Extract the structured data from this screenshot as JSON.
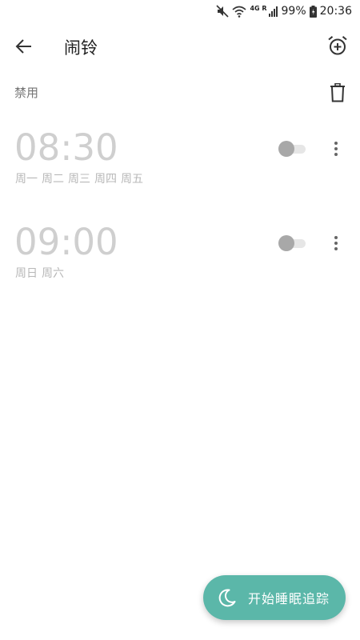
{
  "status_bar": {
    "network": "4G R",
    "battery": "99%",
    "time": "20:36",
    "icons": [
      "mute-icon",
      "wifi-icon",
      "signal-icon",
      "battery-icon"
    ]
  },
  "app_bar": {
    "title": "闹铃",
    "back_icon": "arrow-left-icon",
    "add_icon": "alarm-add-icon"
  },
  "section": {
    "label": "禁用",
    "delete_icon": "trash-icon"
  },
  "alarms": [
    {
      "time": "08:30",
      "days": [
        "周一",
        "周二",
        "周三",
        "周四",
        "周五"
      ],
      "enabled": false
    },
    {
      "time": "09:00",
      "days": [
        "周日",
        "周六"
      ],
      "enabled": false
    }
  ],
  "fab": {
    "label": "开始睡眠追踪",
    "icon": "moon-icon"
  },
  "colors": {
    "accent": "#5bb7a9",
    "time_disabled": "#cfcfcf",
    "days_disabled": "#b8b8b8",
    "section_label": "#757575"
  }
}
